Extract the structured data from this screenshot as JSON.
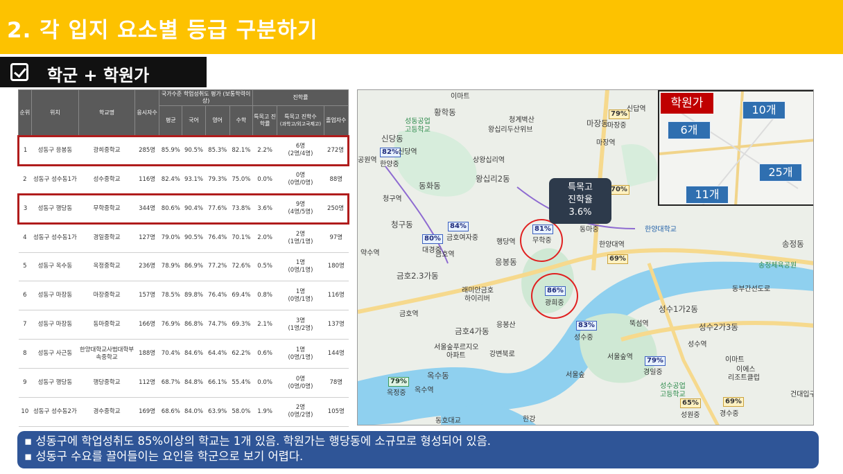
{
  "slide": {
    "title": "2. 각 입지 요소별 등급 구분하기",
    "section_label": "학군 + 학원가"
  },
  "table": {
    "headers": {
      "rank": "순위",
      "location": "위치",
      "school": "학교명",
      "exam_count": "응시자수",
      "achievement_group": "국가수준 학업성취도 평가 (보통학력이상)",
      "avg": "평균",
      "korean": "국어",
      "english": "영어",
      "math": "수학",
      "advance_group": "진학률",
      "special_rate": "특목고 진학률",
      "special_count": "특목고 진학수",
      "special_count_sub": "(과학고/외고국제고)",
      "grads": "졸업자수"
    },
    "rows": [
      {
        "rank": "1",
        "loc": "성동구 응봉동",
        "school": "광희중학교",
        "n": "285명",
        "avg": "85.9%",
        "kor": "90.5%",
        "eng": "85.3%",
        "math": "82.1%",
        "rate": "2.2%",
        "cnt": "6명",
        "cnt_sub": "(2명/4명)",
        "grad": "272명",
        "hl": true
      },
      {
        "rank": "2",
        "loc": "성동구 성수동1가",
        "school": "성수중학교",
        "n": "116명",
        "avg": "82.4%",
        "kor": "93.1%",
        "eng": "79.3%",
        "math": "75.0%",
        "rate": "0.0%",
        "cnt": "0명",
        "cnt_sub": "(0명/0명)",
        "grad": "88명",
        "hl": false
      },
      {
        "rank": "3",
        "loc": "성동구 행당동",
        "school": "무학중학교",
        "n": "344명",
        "avg": "80.6%",
        "kor": "90.4%",
        "eng": "77.6%",
        "math": "73.8%",
        "rate": "3.6%",
        "cnt": "9명",
        "cnt_sub": "(4명/5명)",
        "grad": "250명",
        "hl": true
      },
      {
        "rank": "4",
        "loc": "성동구 성수동1가",
        "school": "경일중학교",
        "n": "127명",
        "avg": "79.0%",
        "kor": "90.5%",
        "eng": "76.4%",
        "math": "70.1%",
        "rate": "2.0%",
        "cnt": "2명",
        "cnt_sub": "(1명/1명)",
        "grad": "97명",
        "hl": false
      },
      {
        "rank": "5",
        "loc": "성동구 옥수동",
        "school": "옥정중학교",
        "n": "236명",
        "avg": "78.9%",
        "kor": "86.9%",
        "eng": "77.2%",
        "math": "72.6%",
        "rate": "0.5%",
        "cnt": "1명",
        "cnt_sub": "(0명/1명)",
        "grad": "180명",
        "hl": false
      },
      {
        "rank": "6",
        "loc": "성동구 마장동",
        "school": "마장중학교",
        "n": "157명",
        "avg": "78.5%",
        "kor": "89.8%",
        "eng": "76.4%",
        "math": "69.4%",
        "rate": "0.8%",
        "cnt": "1명",
        "cnt_sub": "(0명/1명)",
        "grad": "116명",
        "hl": false
      },
      {
        "rank": "7",
        "loc": "성동구 마장동",
        "school": "동마중학교",
        "n": "166명",
        "avg": "76.9%",
        "kor": "86.8%",
        "eng": "74.7%",
        "math": "69.3%",
        "rate": "2.1%",
        "cnt": "3명",
        "cnt_sub": "(1명/2명)",
        "grad": "137명",
        "hl": false
      },
      {
        "rank": "8",
        "loc": "성동구 사근동",
        "school": "한양대학교사범대학부속중학교",
        "n": "188명",
        "avg": "70.4%",
        "kor": "84.6%",
        "eng": "64.4%",
        "math": "62.2%",
        "rate": "0.6%",
        "cnt": "1명",
        "cnt_sub": "(0명/1명)",
        "grad": "144명",
        "hl": false
      },
      {
        "rank": "9",
        "loc": "성동구 행당동",
        "school": "행당중학교",
        "n": "112명",
        "avg": "68.7%",
        "kor": "84.8%",
        "eng": "66.1%",
        "math": "55.4%",
        "rate": "0.0%",
        "cnt": "0명",
        "cnt_sub": "(0명/0명)",
        "grad": "78명",
        "hl": false
      },
      {
        "rank": "10",
        "loc": "성동구 성수동2가",
        "school": "경수중학교",
        "n": "169명",
        "avg": "68.6%",
        "kor": "84.0%",
        "eng": "63.9%",
        "math": "58.0%",
        "rate": "1.9%",
        "cnt": "2명",
        "cnt_sub": "(0명/2명)",
        "grad": "105명",
        "hl": false
      }
    ]
  },
  "map": {
    "inset": {
      "header": "학원가",
      "counts": [
        "10개",
        "6개",
        "25개",
        "11개"
      ]
    },
    "callout": {
      "line1": "특목고",
      "line2": "진학율",
      "line3": "3.6%"
    },
    "markers": [
      "82%",
      "84%",
      "80%",
      "81%",
      "86%",
      "83%",
      "79%",
      "70%",
      "69%",
      "79%",
      "79%",
      "65%",
      "69%"
    ],
    "labels": [
      "황학동",
      "청계벽산",
      "왕십리두산위브",
      "성동공업",
      "고등학교",
      "신당동",
      "신당역",
      "상왕십리역",
      "마장동",
      "마장역",
      "마장중",
      "신답역",
      "한양중",
      "공원역",
      "왕십리2동",
      "청구역",
      "동화동",
      "청구동",
      "대경중",
      "금호여자중",
      "금호역",
      "행당역",
      "무학중",
      "동마중",
      "한양대역",
      "한양대학교",
      "응봉산",
      "광희중",
      "성수중",
      "금호2.3가동",
      "금호4가동",
      "옥수동",
      "옥수역",
      "옥정중",
      "서울숲역",
      "뚝섬역",
      "성수역",
      "경일중",
      "성수1가2동",
      "성수2가3동",
      "성원중",
      "경수중",
      "송정동",
      "송정체육공원",
      "동부간선도로",
      "서울숲",
      "한강",
      "강변북로",
      "동호대교",
      "건대입구",
      "이마트",
      "이마트",
      "이에스",
      "리조트클럽",
      "성수공업",
      "고등학교",
      "서울숲푸르지오",
      "아파트",
      "래미안금호",
      "하이리버",
      "응봉동",
      "약수역",
      "금호역"
    ]
  },
  "summary": {
    "line1": "▪ 성동구에 학업성취도 85%이상의 학교는 1개 있음. 학원가는 행당동에 소규모로 형성되어 있음.",
    "line2": "▪ 성동구 수요를 끌어들이는 요인을 학군으로 보기 어렵다."
  }
}
